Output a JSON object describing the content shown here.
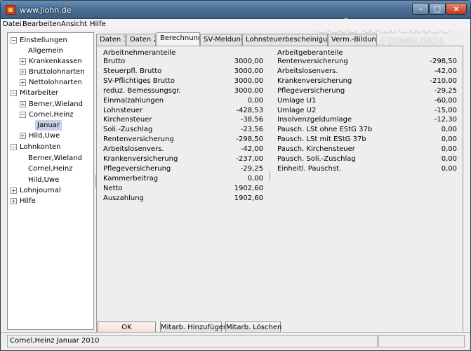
{
  "window": {
    "title": "www.jlohn.de"
  },
  "watermark": {
    "main": "soft-ware.net",
    "sub": "AKTUELLE DOWNLOADS"
  },
  "menu": {
    "items": [
      "Datei",
      "Bearbeiten",
      "Ansicht",
      "Hilfe"
    ]
  },
  "tree": {
    "einstellungen": "Einstellungen",
    "allgemein": "Allgemein",
    "krankenkassen": "Krankenkassen",
    "bruttolohnarten": "Bruttolohnarten",
    "nettolohnarten": "Nettolohnarten",
    "mitarbeiter": "Mitarbeiter",
    "berner": "Berner,Wieland",
    "cornel": "Cornel,Heinz",
    "januar": "Januar",
    "hild": "Hild,Uwe",
    "lohnkonten": "Lohnkonten",
    "lk_berner": "Berner,Wieland",
    "lk_cornel": "Cornel,Heinz",
    "lk_hild": "Hild,Uwe",
    "lohnjournal": "Lohnjournal",
    "hilfe": "Hilfe"
  },
  "tabs": [
    "Daten 1",
    "Daten 2",
    "Berechnung",
    "SV-Meldung",
    "Lohnsteuerbescheinigung",
    "Verm.-Bildung"
  ],
  "arbeitnehmer": {
    "title": "Arbeitnehmeranteile",
    "rows": [
      {
        "label": "Brutto",
        "value": "3000,00"
      },
      {
        "label": "Steuerpfl. Brutto",
        "value": "3000,00"
      },
      {
        "label": "SV-Pflichtiges Brutto",
        "value": "3000,00"
      },
      {
        "label": "reduz. Bemessungsgr.",
        "value": "3000,00"
      },
      {
        "label": "Einmalzahlungen",
        "value": "0,00"
      },
      {
        "label": "Lohnsteuer",
        "value": "-428,53"
      },
      {
        "label": "Kirchensteuer",
        "value": "-38,56"
      },
      {
        "label": "Soli.-Zuschlag",
        "value": "-23,56"
      },
      {
        "label": "Rentenversicherung",
        "value": "-298,50"
      },
      {
        "label": "Arbeitslosenvers.",
        "value": "-42,00"
      },
      {
        "label": "Krankenversicherung",
        "value": "-237,00"
      },
      {
        "label": "Pflegeversicherung",
        "value": "-29,25"
      },
      {
        "label": "Kammerbeitrag",
        "value": "0,00"
      },
      {
        "label": "Netto",
        "value": "1902,60"
      },
      {
        "label": "Auszahlung",
        "value": "1902,60"
      }
    ]
  },
  "arbeitgeber": {
    "title": "Arbeitgeberanteile",
    "rows": [
      {
        "label": "Rentenversicherung",
        "value": "-298,50"
      },
      {
        "label": "Arbeitslosenvers.",
        "value": "-42,00"
      },
      {
        "label": "Krankenversicherung",
        "value": "-210,00"
      },
      {
        "label": "Pflegeversicherung",
        "value": "-29,25"
      },
      {
        "label": "Umlage U1",
        "value": "-60,00"
      },
      {
        "label": "Umlage U2",
        "value": "-15,00"
      },
      {
        "label": "Insolvenzgeldumlage",
        "value": "-12,30"
      },
      {
        "label": "Pausch. LSt ohne EStG 37b",
        "value": "0,00"
      },
      {
        "label": "Pausch. LSt mit EStG 37b",
        "value": "0,00"
      },
      {
        "label": "Pausch. Kirchensteuer",
        "value": "0,00"
      },
      {
        "label": "Pausch. Soli.-Zuschlag",
        "value": "0,00"
      },
      {
        "label": "Einheitl. Pauschst.",
        "value": "0,00"
      }
    ]
  },
  "buttons": {
    "ok": "OK",
    "add": "Mitarb. Hinzufügen",
    "delete": "Mitarb. Löschen"
  },
  "status": {
    "text": "Cornel,Heinz Januar 2010"
  }
}
